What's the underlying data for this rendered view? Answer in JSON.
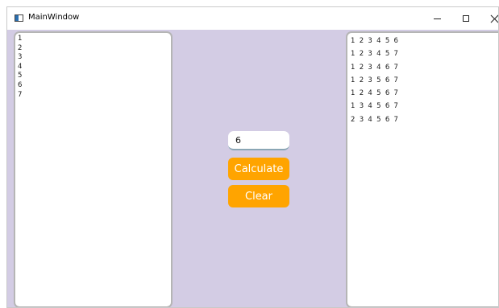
{
  "window": {
    "title": "MainWindow",
    "controls": {
      "minimize": "–",
      "maximize": "☐",
      "close": "✕"
    }
  },
  "left_list": {
    "items": [
      "1",
      "2",
      "3",
      "4",
      "5",
      "6",
      "7"
    ]
  },
  "input": {
    "value": "6"
  },
  "buttons": {
    "calculate": "Calculate",
    "clear": "Clear"
  },
  "right_list": {
    "items": [
      "1 2 3 4 5 6",
      "1 2 3 4 5 7",
      "1 2 3 4 6 7",
      "1 2 3 5 6 7",
      "1 2 4 5 6 7",
      "1 3 4 5 6 7",
      "2 3 4 5 6 7"
    ]
  },
  "colors": {
    "client_background": "#d3cce4",
    "button_background": "#ffa400",
    "button_text": "#ffffff"
  },
  "icons": {
    "app": "window-app-icon",
    "minimize": "minimize-icon",
    "maximize": "maximize-icon",
    "close": "close-icon"
  }
}
